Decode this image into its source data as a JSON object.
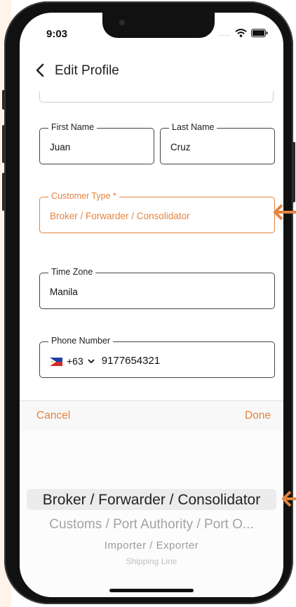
{
  "status": {
    "time": "9:03",
    "dots": "...."
  },
  "header": {
    "title": "Edit Profile"
  },
  "form": {
    "first_name": {
      "label": "First Name",
      "value": "Juan"
    },
    "last_name": {
      "label": "Last Name",
      "value": "Cruz"
    },
    "customer_type": {
      "label": "Customer Type *",
      "value": "Broker / Forwarder / Consolidator"
    },
    "time_zone": {
      "label": "Time Zone",
      "value": "Manila"
    },
    "phone": {
      "label": "Phone Number",
      "code": "+63",
      "value": "9177654321"
    }
  },
  "picker": {
    "cancel": "Cancel",
    "done": "Done",
    "options": [
      "Broker / Forwarder / Consolidator",
      "Customs / Port Authority / Port O...",
      "Importer / Exporter",
      "Shipping Line"
    ]
  },
  "colors": {
    "accent": "#e4833f"
  }
}
